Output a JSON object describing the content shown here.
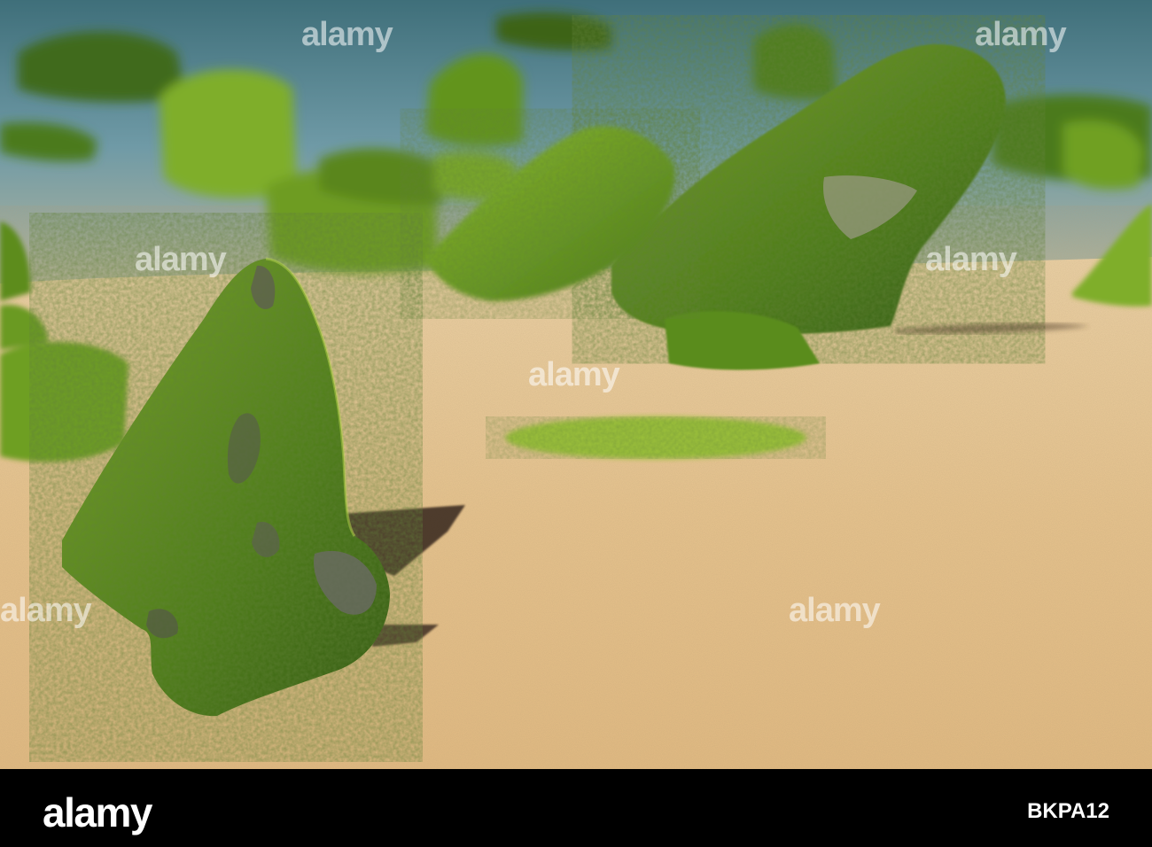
{
  "watermark": "alamy",
  "footer": {
    "brand": "alamy",
    "image_id": "BKPA12"
  },
  "colors": {
    "sand": "#e8c48e",
    "algae": "#5c8f1c",
    "sea": "#5e8fa3",
    "bar": "#000000"
  }
}
